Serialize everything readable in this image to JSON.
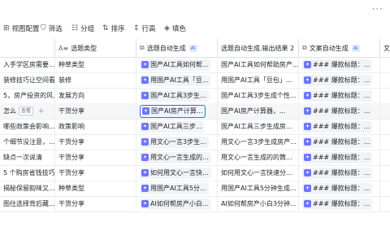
{
  "toolbar": {
    "items": [
      {
        "icon": "⊞",
        "label": "视图配置"
      },
      {
        "icon": "⛉",
        "label": "筛选"
      },
      {
        "icon": "☷",
        "label": "分组"
      },
      {
        "icon": "⇅",
        "label": "排序"
      },
      {
        "icon": "↕",
        "label": "行高"
      },
      {
        "icon": "◈",
        "label": "填色"
      }
    ],
    "more": "···"
  },
  "columns": [
    {
      "icon": "",
      "label": ""
    },
    {
      "icon": "A≡",
      "label": "选题类型"
    },
    {
      "icon": "⧉",
      "label": "选题自动生成",
      "tag": "AI"
    },
    {
      "icon": "",
      "label": "选题自动生成.输出结果 2"
    },
    {
      "icon": "⧉",
      "label": "文案自动生成",
      "tag": "AI"
    },
    {
      "icon": "",
      "label": "文"
    }
  ],
  "open_label": "查看",
  "rows": [
    {
      "c0": "入手学区房需要...",
      "c1": "种草类型",
      "c2": "国产AI工具如何帮...",
      "c3": "国产AI工具如何帮助房产...",
      "c4": "### 爆款标题：..."
    },
    {
      "c0": "装修技巧让空间看...",
      "c1": "装修",
      "c2": "用国产AI工具「豆...",
      "c3": "用国产AI工具「豆包」...",
      "c4": "### 爆款标题：..."
    },
    {
      "c0": "5，房产投资的风...",
      "c1": "发展方向",
      "c2": "国产AI工具3步生...",
      "c3": "国产AI工具3步生成个性...",
      "c4": "### 爆款标题：..."
    },
    {
      "c0": "怎么",
      "c1": "干货分享",
      "c2": "国产AI房产计算...",
      "c3": "国产AI房产计算器，...",
      "c4": "### 爆款标题：..."
    },
    {
      "c0": "哪些政策会影响...",
      "c1": "政策影响",
      "c2": "国产AI工具三步...",
      "c3": "国产AI工具三步生成房...",
      "c4": "### 爆款标题：..."
    },
    {
      "c0": "个细节没注意，...",
      "c1": "干货分享",
      "c2": "用文心一言3步生...",
      "c3": "用文心一言3步生成房产...",
      "c4": "### 爆款标题：..."
    },
    {
      "c0": "缺点一次说清",
      "c1": "干货分享",
      "c2": "用文心一言生成的...",
      "c3": "用文心一言生成的的筒...",
      "c4": "### 爆款标题：..."
    },
    {
      "c0": "5 个购房省钱技巧",
      "c1": "干货分享",
      "c2": "如何用文心一言快...",
      "c3": "如何用文心一言快速分...",
      "c4": "### 爆款标题：..."
    },
    {
      "c0": "揭秘保留韵味又...",
      "c1": "种草类型",
      "c2": "用国产AI工具5分...",
      "c3": "用国产AI工具5分钟生成...",
      "c4": "### 爆款标题：..."
    },
    {
      "c0": "图住选择背后藏...",
      "c1": "干货分享",
      "c2": "AI如何帮房产小白...",
      "c3": "AI如何帮房产小白3分钟...",
      "c4": "### 爆款标题：..."
    }
  ]
}
